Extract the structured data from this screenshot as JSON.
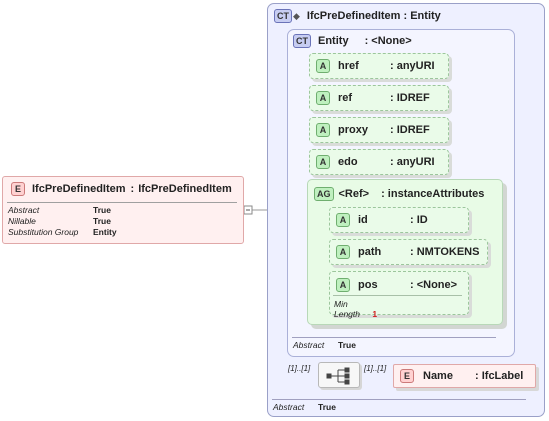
{
  "root_element": {
    "badge": "E",
    "name": "IfcPreDefinedItem",
    "separator": ":",
    "type": "IfcPreDefinedItem",
    "properties": [
      {
        "label": "Abstract",
        "value": "True"
      },
      {
        "label": "Nillable",
        "value": "True"
      },
      {
        "label": "Substitution Group",
        "value": "Entity"
      }
    ]
  },
  "complex_type": {
    "badge": "CT",
    "title": "IfcPreDefinedItem : Entity",
    "abstract_label": "Abstract",
    "abstract_value": "True"
  },
  "base_type": {
    "badge": "CT",
    "name": "Entity",
    "type": ": <None>",
    "abstract_label": "Abstract",
    "abstract_value": "True",
    "attributes": [
      {
        "badge": "A",
        "name": "href",
        "type": ": anyURI"
      },
      {
        "badge": "A",
        "name": "ref",
        "type": ": IDREF"
      },
      {
        "badge": "A",
        "name": "proxy",
        "type": ": IDREF"
      },
      {
        "badge": "A",
        "name": "edo",
        "type": ": anyURI"
      }
    ],
    "attribute_group": {
      "badge": "AG",
      "name": "<Ref>",
      "type": ": instanceAttributes",
      "attributes": [
        {
          "badge": "A",
          "name": "id",
          "type": ": ID"
        },
        {
          "badge": "A",
          "name": "path",
          "type": ": NMTOKENS"
        },
        {
          "badge": "A",
          "name": "pos",
          "type": ": <None>",
          "min_length_label": "Min Length",
          "min_length_value": "1"
        }
      ]
    }
  },
  "sequence": {
    "cardinality_left": "[1]..[1]",
    "cardinality_right": "[1]..[1]"
  },
  "child_element": {
    "badge": "E",
    "name": "Name",
    "type": ": IfcLabel"
  },
  "colors": {
    "element_fill": "#fff0f0",
    "attribute_fill": "#eafbe9",
    "complex_type_fill": "#eef0ff",
    "min_length_value": "#d02020"
  }
}
